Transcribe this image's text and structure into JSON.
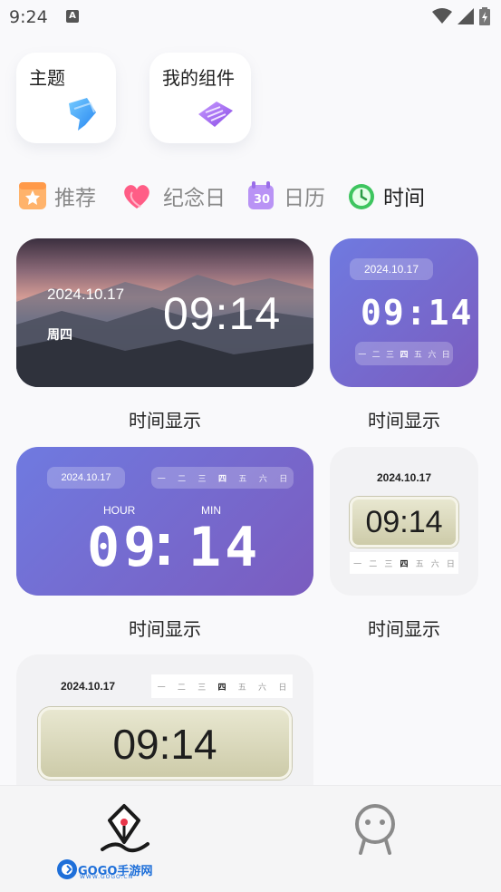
{
  "status": {
    "time": "9:24",
    "notif_icon": "A"
  },
  "top_cards": [
    {
      "title": "主题"
    },
    {
      "title": "我的组件"
    }
  ],
  "tabs": [
    {
      "label": "推荐",
      "icon": "star-icon"
    },
    {
      "label": "纪念日",
      "icon": "heart-icon"
    },
    {
      "label": "日历",
      "icon": "calendar-icon",
      "badge": "30"
    },
    {
      "label": "时间",
      "icon": "clock-icon",
      "active": true
    }
  ],
  "widgets": {
    "w1": {
      "date": "2024.10.17",
      "weekday": "周四",
      "time": "09:14",
      "caption": "时间显示"
    },
    "w2": {
      "date": "2024.10.17",
      "time": "09:14",
      "days": [
        "一",
        "二",
        "三",
        "四",
        "五",
        "六",
        "日"
      ],
      "caption": "时间显示"
    },
    "w3": {
      "date": "2024.10.17",
      "hour_label": "HOUR",
      "min_label": "MIN",
      "hour": "09",
      "min": "14",
      "days": [
        "一",
        "二",
        "三",
        "四",
        "五",
        "六",
        "日"
      ],
      "caption": "时间显示"
    },
    "w4": {
      "date": "2024.10.17",
      "time": "09:14",
      "days": [
        "一",
        "二",
        "三",
        "四",
        "五",
        "六",
        "日"
      ],
      "caption": "时间显示"
    },
    "w5": {
      "date": "2024.10.17",
      "time": "09:14",
      "days": [
        "一",
        "二",
        "三",
        "四",
        "五",
        "六",
        "日"
      ]
    }
  },
  "current_day_index": 3,
  "watermark": {
    "brand": "GOGO手游网",
    "sub": "WWW.GOGO.CN"
  },
  "colors": {
    "accent_purple": "#7468d4",
    "bg": "#f9f9fb"
  }
}
